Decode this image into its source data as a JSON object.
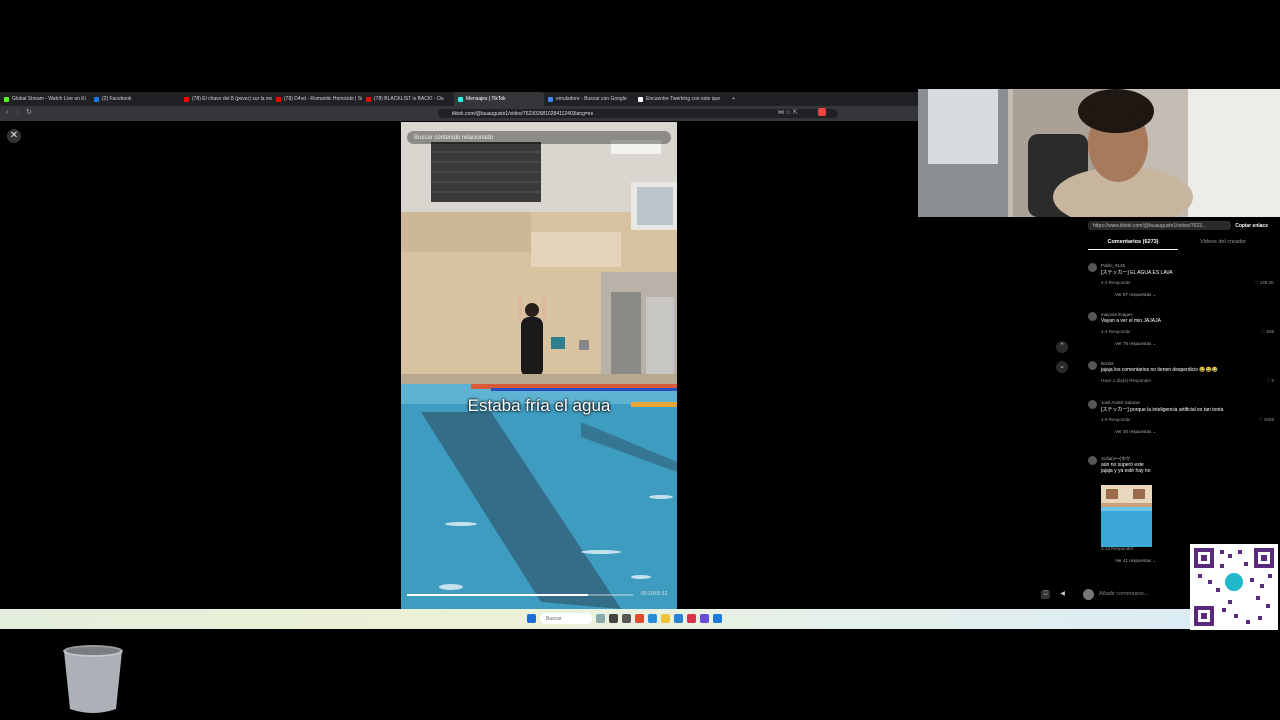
{
  "browser": {
    "tabs": [
      {
        "label": "Global Stream - Watch Live on Ki",
        "color": "#53fc18"
      },
      {
        "label": "(2) Facebook",
        "color": "#1877f2"
      },
      {
        "label": "(78) El chavo del 8 (pover) sur la mej",
        "color": "#ff0000"
      },
      {
        "label": "(78) D4vd - Romantic Homicide | Sub",
        "color": "#ff0000"
      },
      {
        "label": "(78) BLACKLIST is BACK! - Ou",
        "color": "#ff0000"
      },
      {
        "label": "Mensajes | TikTok",
        "color": "#25f4ee",
        "active": true
      },
      {
        "label": "emuladore - Buscar con Google",
        "color": "#4285f4"
      },
      {
        "label": "Encuentre Twerking con este que",
        "color": "#ffffff"
      }
    ],
    "new_tab": "+",
    "url": "tiktok.com/@lauaugusto1/video/7623026810284112403lang=es"
  },
  "video": {
    "search_placeholder": "Buscar contenido relacionado",
    "caption": "Estaba fría el agua",
    "time": "00:10/00:12",
    "progress": 0.8
  },
  "controls": {
    "close": "✕",
    "up": "⌃",
    "down": "⌄"
  },
  "panel": {
    "link": "https://www.tiktok.com/@lauaugusto1/video/7623...",
    "copy_label": "Copiar enlace",
    "tab_comments": "Comentarios (6273)",
    "tab_videos": "Videos del creador",
    "add_comment_placeholder": "Añadir comentario...",
    "reply_label": "Responder"
  },
  "comments": [
    {
      "user": "Pablo_9126",
      "text": "[ステッカー] EL AGUA ES LAVA",
      "meta": "4-3   Responder",
      "likes": "♡ 149.2K",
      "replies": "Ver 97 respuestas ⌄"
    },
    {
      "user": "mayosa images",
      "text": "Vayan a ver el mio JAJAJA",
      "meta": "4-4   Responder",
      "likes": "♡ 639",
      "replies": "Ver 75 respuestas ⌄"
    },
    {
      "user": "Bordis",
      "text": "jajaja los comentarios no tienen desperdicio 😂😂😂",
      "meta": "Hace 1 día(s)   Responder",
      "likes": "♡ 0",
      "replies": ""
    },
    {
      "user": "José André Salazar",
      "text": "[ステッカー] porque la inteligencia artificial es tan tonta",
      "meta": "4-9   Responder",
      "likes": "♡ 3258",
      "replies": "Ver 30 respuestas ⌄"
    },
    {
      "user": "Sofia(o•-•)ゆか",
      "text": "aún no superó este",
      "text2": "jajaja y ya esté hay no",
      "meta": "4-12   Responder",
      "likes": "",
      "replies": "Ver 41 respuestas ⌄"
    }
  ],
  "taskbar": {
    "search_label": "Buscar"
  }
}
